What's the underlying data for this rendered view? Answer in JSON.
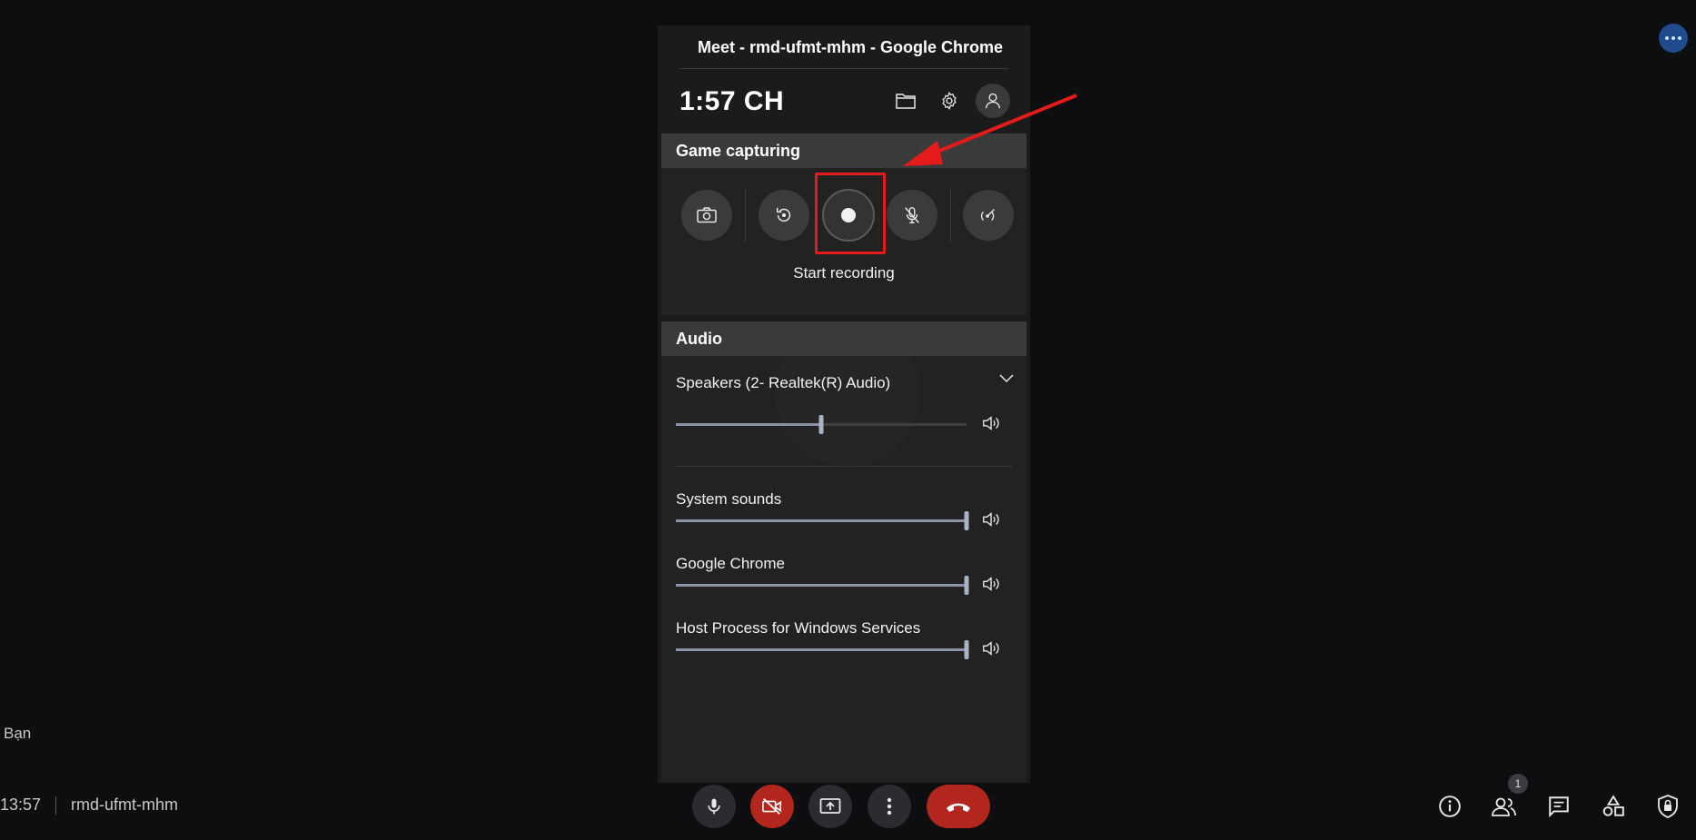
{
  "window": {
    "title": "Meet - rmd-ufmt-mhm - Google Chrome"
  },
  "gamebar": {
    "clock": "1:57 CH",
    "capture_section": "Game capturing",
    "capture_caption": "Start recording",
    "audio_section": "Audio",
    "audio_device": "Speakers (2- Realtek(R) Audio)",
    "master_volume": 0.5,
    "apps": [
      {
        "name": "System sounds",
        "volume": 1.0
      },
      {
        "name": "Google Chrome",
        "volume": 1.0
      },
      {
        "name": "Host Process for Windows Services",
        "volume": 1.0
      }
    ]
  },
  "meet": {
    "self_label": "Bạn",
    "time": "13:57",
    "meeting_code": "rmd-ufmt-mhm",
    "participants_count": "1"
  },
  "colors": {
    "annotation_red": "#e41b1b",
    "hangup_red": "#b3261e",
    "panel_bg": "#1b1b1b",
    "slider_fill": "#8a93a6"
  },
  "icons": [
    "folder-icon",
    "gear-icon",
    "user-icon",
    "camera-icon",
    "replay-icon",
    "record-icon",
    "mic-off-icon",
    "broadcast-icon",
    "chevron-down-icon",
    "speaker-icon",
    "mic-icon",
    "camera-off-icon",
    "present-icon",
    "more-vert-icon",
    "phone-hangup-icon",
    "info-icon",
    "people-icon",
    "chat-icon",
    "activities-icon",
    "shield-icon"
  ]
}
